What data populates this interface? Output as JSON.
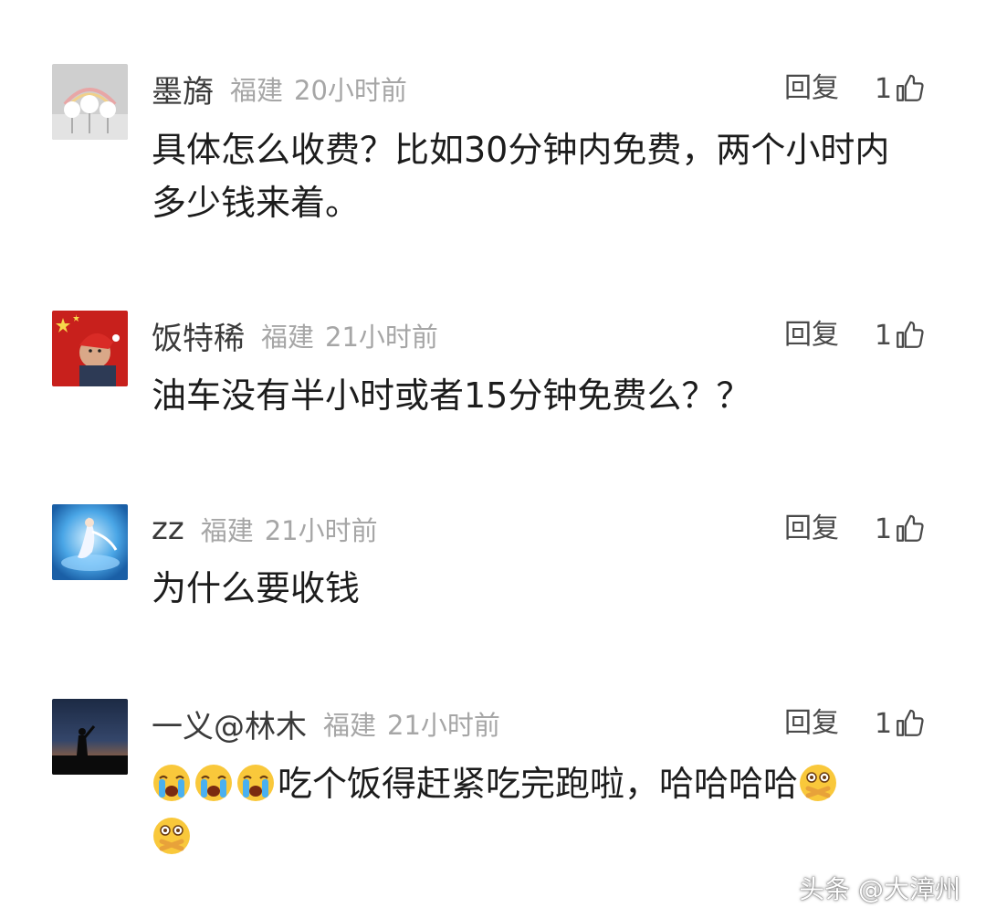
{
  "comments": [
    {
      "username": "墨旖",
      "location": "福建",
      "time": "20小时前",
      "reply_label": "回复",
      "likes": "1",
      "text": "具体怎么收费？比如30分钟内免费，两个小时内多少钱来着。"
    },
    {
      "username": "饭特稀",
      "location": "福建",
      "time": "21小时前",
      "reply_label": "回复",
      "likes": "1",
      "text": "油车没有半小时或者15分钟免费么？？"
    },
    {
      "username": "zz",
      "location": "福建",
      "time": "21小时前",
      "reply_label": "回复",
      "likes": "1",
      "text": "为什么要收钱"
    },
    {
      "username": "一义@林木",
      "location": "福建",
      "time": "21小时前",
      "reply_label": "回复",
      "likes": "1",
      "text": "吃个饭得赶紧吃完跑啦，哈哈哈哈"
    }
  ],
  "icons": {
    "like": "thumbs-up-icon",
    "crying": "loudly-crying-face-emoji",
    "speechless": "hand-over-mouth-face-emoji"
  },
  "watermark": "头条 @大漳州"
}
